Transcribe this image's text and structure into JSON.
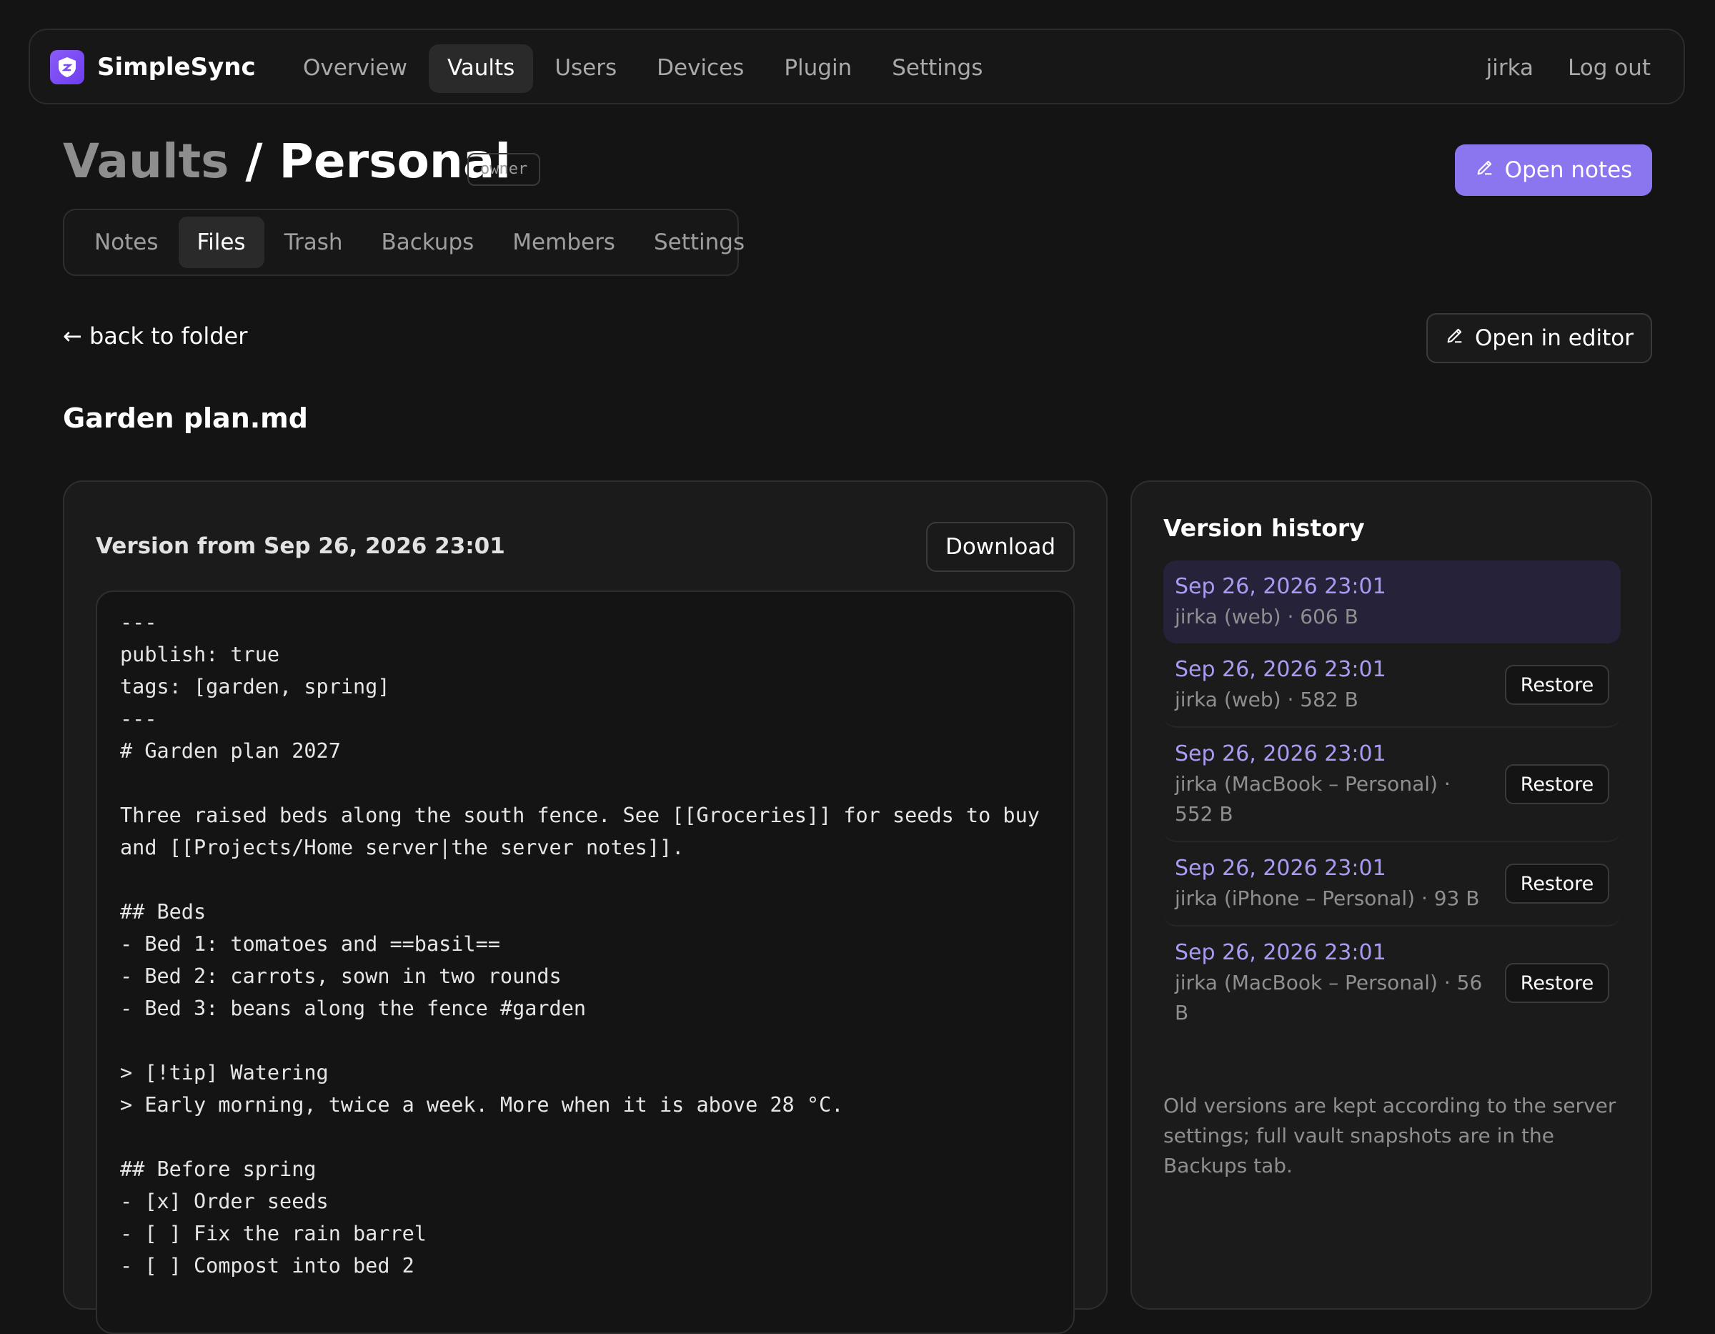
{
  "app": {
    "name": "SimpleSync"
  },
  "nav": {
    "items": [
      {
        "label": "Overview",
        "active": false
      },
      {
        "label": "Vaults",
        "active": true
      },
      {
        "label": "Users",
        "active": false
      },
      {
        "label": "Devices",
        "active": false
      },
      {
        "label": "Plugin",
        "active": false
      },
      {
        "label": "Settings",
        "active": false
      }
    ],
    "user": "jirka",
    "logout": "Log out"
  },
  "page": {
    "crumb": "Vaults",
    "separator": " / ",
    "title": "Personal",
    "role_badge": "owner",
    "open_notes": "Open notes"
  },
  "tabs": [
    {
      "label": "Notes",
      "active": false
    },
    {
      "label": "Files",
      "active": true
    },
    {
      "label": "Trash",
      "active": false
    },
    {
      "label": "Backups",
      "active": false
    },
    {
      "label": "Members",
      "active": false
    },
    {
      "label": "Settings",
      "active": false
    }
  ],
  "file": {
    "back": "← back to folder",
    "open_in_editor": "Open in editor",
    "name": "Garden plan.md",
    "version_title": "Version from Sep 26, 2026 23:01",
    "download": "Download",
    "content": "---\npublish: true\ntags: [garden, spring]\n---\n# Garden plan 2027\n\nThree raised beds along the south fence. See [[Groceries]] for seeds to buy\nand [[Projects/Home server|the server notes]].\n\n## Beds\n- Bed 1: tomatoes and ==basil==\n- Bed 2: carrots, sown in two rounds\n- Bed 3: beans along the fence #garden\n\n> [!tip] Watering\n> Early morning, twice a week. More when it is above 28 °C.\n\n## Before spring\n- [x] Order seeds\n- [ ] Fix the rain barrel\n- [ ] Compost into bed 2"
  },
  "history": {
    "title": "Version history",
    "restore_label": "Restore",
    "versions": [
      {
        "date": "Sep 26, 2026 23:01",
        "meta": "jirka (web) · 606 B",
        "current": true
      },
      {
        "date": "Sep 26, 2026 23:01",
        "meta": "jirka (web) · 582 B",
        "current": false
      },
      {
        "date": "Sep 26, 2026 23:01",
        "meta": "jirka (MacBook – Personal) · 552 B",
        "current": false
      },
      {
        "date": "Sep 26, 2026 23:01",
        "meta": "jirka (iPhone – Personal) · 93 B",
        "current": false
      },
      {
        "date": "Sep 26, 2026 23:01",
        "meta": "jirka (MacBook – Personal) · 56 B",
        "current": false
      }
    ],
    "note": "Old versions are kept according to the server settings; full vault snapshots are in the Backups tab."
  },
  "icons": {
    "logo": "shield-logo-icon",
    "edit": "pencil-icon"
  },
  "colors": {
    "accent": "#8b76f0",
    "version_date": "#a99bf2",
    "background": "#141414"
  }
}
